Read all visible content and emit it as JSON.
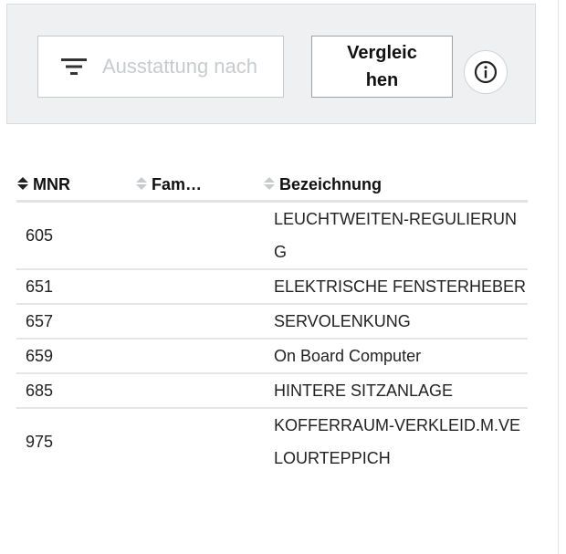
{
  "filter": {
    "search_placeholder": "Ausstattung nach",
    "search_value": "",
    "filter_icon": "filter-lines-icon",
    "compare_label": "Vergleichen",
    "info_icon": "info-icon"
  },
  "table": {
    "columns": [
      {
        "label": "MNR",
        "sort_icon": "sort-icon"
      },
      {
        "label": "Fam…",
        "sort_icon": "sort-icon"
      },
      {
        "label": "Bezeichnung",
        "sort_icon": "sort-icon"
      }
    ],
    "rows": [
      {
        "mnr": "605",
        "fam": "",
        "bezeichnung": "LEUCHTWEITEN-REGULIERUNG"
      },
      {
        "mnr": "651",
        "fam": "",
        "bezeichnung": "ELEKTRISCHE FENSTERHEBER"
      },
      {
        "mnr": "657",
        "fam": "",
        "bezeichnung": "SERVOLENKUNG"
      },
      {
        "mnr": "659",
        "fam": "",
        "bezeichnung": "On Board Computer"
      },
      {
        "mnr": "685",
        "fam": "",
        "bezeichnung": "HINTERE SITZANLAGE"
      },
      {
        "mnr": "975",
        "fam": "",
        "bezeichnung": "KOFFERRAUM-VERKLEID.M.VELOURTEPPICH"
      }
    ]
  },
  "colors": {
    "panel_bg": "#eef0f1",
    "row_divider": "#e3e5e6",
    "text": "#222222"
  }
}
